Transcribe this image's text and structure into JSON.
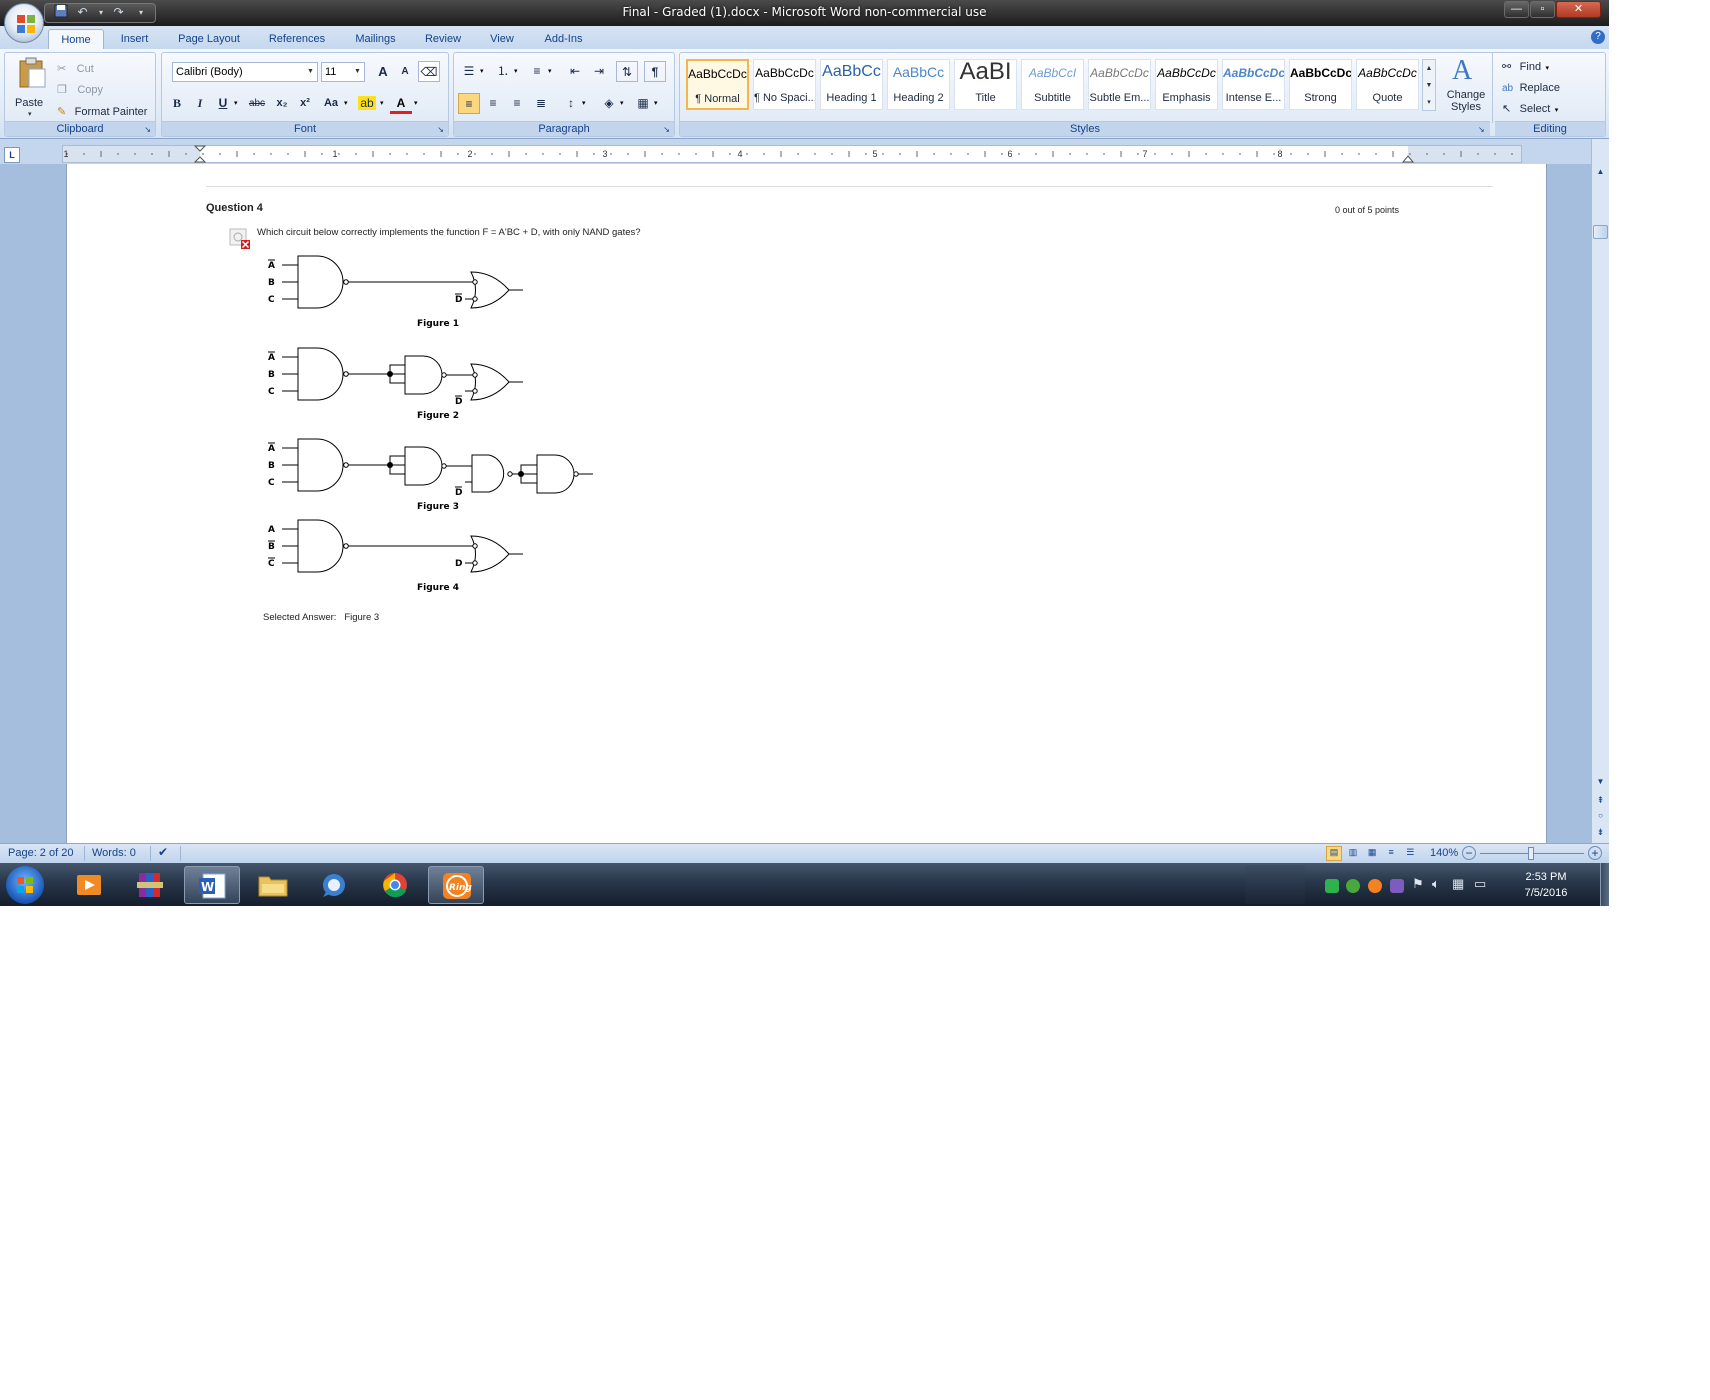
{
  "window": {
    "title": "Final - Graded (1).docx - Microsoft Word non-commercial use",
    "controls": {
      "minimize": "—",
      "maximize": "▫",
      "close": "✕"
    }
  },
  "tabs": [
    "Home",
    "Insert",
    "Page Layout",
    "References",
    "Mailings",
    "Review",
    "View",
    "Add-Ins"
  ],
  "clipboard": {
    "paste": "Paste",
    "cut": "Cut",
    "copy": "Copy",
    "format_painter": "Format Painter",
    "label": "Clipboard"
  },
  "font": {
    "name": "Calibri (Body)",
    "size": "11",
    "label": "Font",
    "bold": "B",
    "italic": "I",
    "underline": "U",
    "strike": "abc",
    "sub": "x₂",
    "sup": "x²",
    "case": "Aa",
    "grow": "A",
    "shrink": "A"
  },
  "paragraph": {
    "label": "Paragraph",
    "show": "¶"
  },
  "styles": {
    "label": "Styles",
    "items": [
      {
        "sample": "AaBbCcDc",
        "name": "¶ Normal"
      },
      {
        "sample": "AaBbCcDc",
        "name": "¶ No Spaci..."
      },
      {
        "sample": "AaBbCc",
        "name": "Heading 1"
      },
      {
        "sample": "AaBbCc",
        "name": "Heading 2"
      },
      {
        "sample": "AaBI",
        "name": "Title"
      },
      {
        "sample": "AaBbCcI",
        "name": "Subtitle"
      },
      {
        "sample": "AaBbCcDc",
        "name": "Subtle Em..."
      },
      {
        "sample": "AaBbCcDc",
        "name": "Emphasis"
      },
      {
        "sample": "AaBbCcDc",
        "name": "Intense E..."
      },
      {
        "sample": "AaBbCcDc",
        "name": "Strong"
      },
      {
        "sample": "AaBbCcDc",
        "name": "Quote"
      }
    ],
    "change": "Change Styles"
  },
  "editing": {
    "label": "Editing",
    "find": "Find",
    "replace": "Replace",
    "select": "Select"
  },
  "ruler": {
    "numbers": [
      "1",
      "1",
      "2",
      "3",
      "4",
      "5",
      "6",
      "7",
      "8"
    ]
  },
  "document": {
    "question_title": "Question 4",
    "points": "0 out of 5 points",
    "question": "Which circuit below correctly implements the function F = A'BC + D, with only NAND gates?",
    "figures": [
      {
        "inputs": [
          "A",
          "B",
          "C"
        ],
        "second": "D",
        "caption": "Figure 1"
      },
      {
        "inputs": [
          "A",
          "B",
          "C"
        ],
        "second": "D",
        "caption": "Figure 2"
      },
      {
        "inputs": [
          "A",
          "B",
          "C"
        ],
        "second": "D",
        "caption": "Figure 3"
      },
      {
        "inputs": [
          "A",
          "B",
          "C"
        ],
        "second": "D",
        "caption": "Figure 4"
      }
    ],
    "selected_label": "Selected Answer:",
    "selected_value": "Figure 3"
  },
  "status": {
    "page": "Page: 2 of 20",
    "words": "Words: 0",
    "zoom": "140%"
  },
  "taskbar": {
    "time": "2:53 PM",
    "date": "7/5/2016"
  },
  "colors": {
    "ribbon_text": "#15428b",
    "accent_red": "#d11f1f",
    "taskbar": "#1b2636"
  }
}
